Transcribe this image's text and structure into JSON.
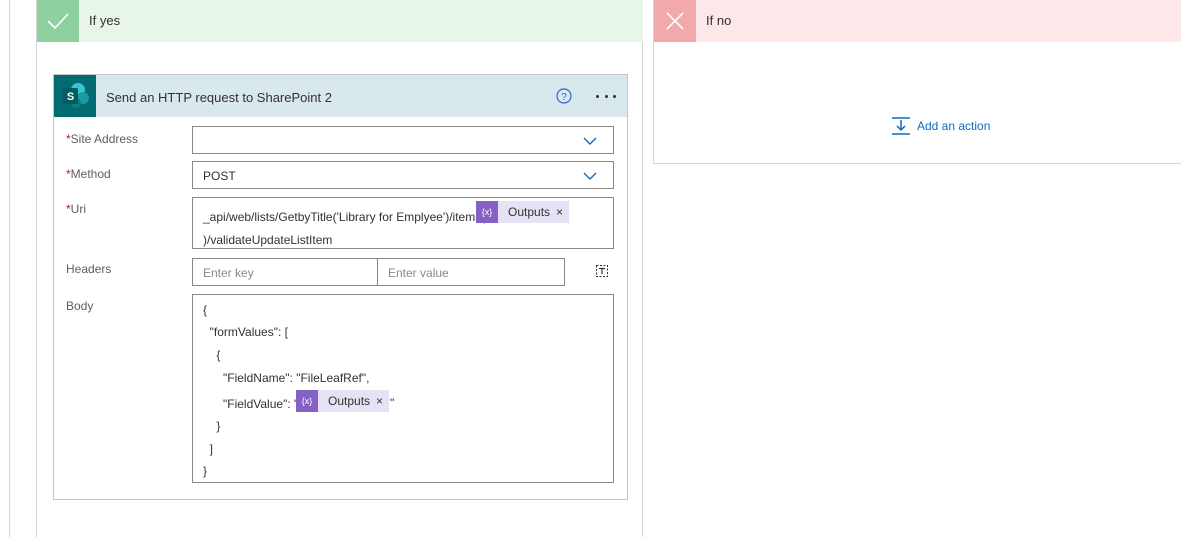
{
  "branches": {
    "yes": {
      "title": "If yes"
    },
    "no": {
      "title": "If no",
      "add_action_label": "Add an action"
    }
  },
  "action_card": {
    "title": "Send an HTTP request to SharePoint 2",
    "logo_letter": "S",
    "fields": {
      "site_address": {
        "label": "Site Address",
        "required_marker": "*",
        "value": ""
      },
      "method": {
        "label": "Method",
        "required_marker": "*",
        "value": "POST"
      },
      "uri": {
        "label": "Uri",
        "required_marker": "*",
        "line1_prefix": "_api/web/lists/GetbyTitle('Library for Emplyee')/items(",
        "line2": ")/validateUpdateListItem"
      },
      "headers": {
        "label": "Headers",
        "key_placeholder": "Enter key",
        "value_placeholder": "Enter value"
      },
      "body": {
        "label": "Body",
        "lines": [
          "{",
          "  \"formValues\": [",
          "    {",
          "      \"FieldName\": \"FileLeafRef\",",
          "      \"FieldValue\": \"",
          "    }",
          "  ]",
          "}"
        ],
        "fieldvalue_suffix": "\""
      }
    },
    "token": {
      "label": "Outputs",
      "close": "×",
      "icon_glyph": "{x}"
    }
  },
  "colors": {
    "yes_header_bg": "#e8f5e9",
    "yes_check_bg": "#8fd19e",
    "no_header_bg": "#fde7e9",
    "no_x_bg": "#f1a9a9",
    "card_header_bg": "#d9e8ec",
    "sharepoint_teal": "#036c70",
    "token_purple": "#8661c5",
    "link_blue": "#0f6cbd",
    "required_red": "#a4262c"
  },
  "icons": [
    "check-icon",
    "close-icon",
    "sharepoint-logo-icon",
    "help-icon",
    "more-options-icon",
    "chevron-down-icon",
    "insert-action-icon",
    "switch-to-text-mode-icon",
    "expression-icon"
  ]
}
